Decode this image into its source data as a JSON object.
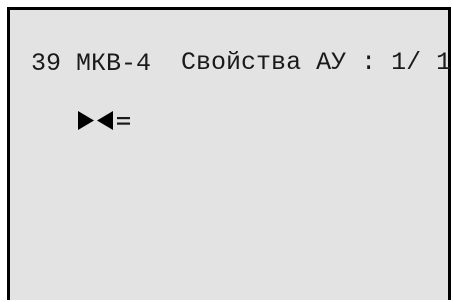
{
  "header": {
    "nav_glyph": "▶◀=",
    "title": "Свойства АУ",
    "separator": ":",
    "page": "1/ 1"
  },
  "items": [
    {
      "number": "39",
      "name": "МКВ-4"
    }
  ]
}
